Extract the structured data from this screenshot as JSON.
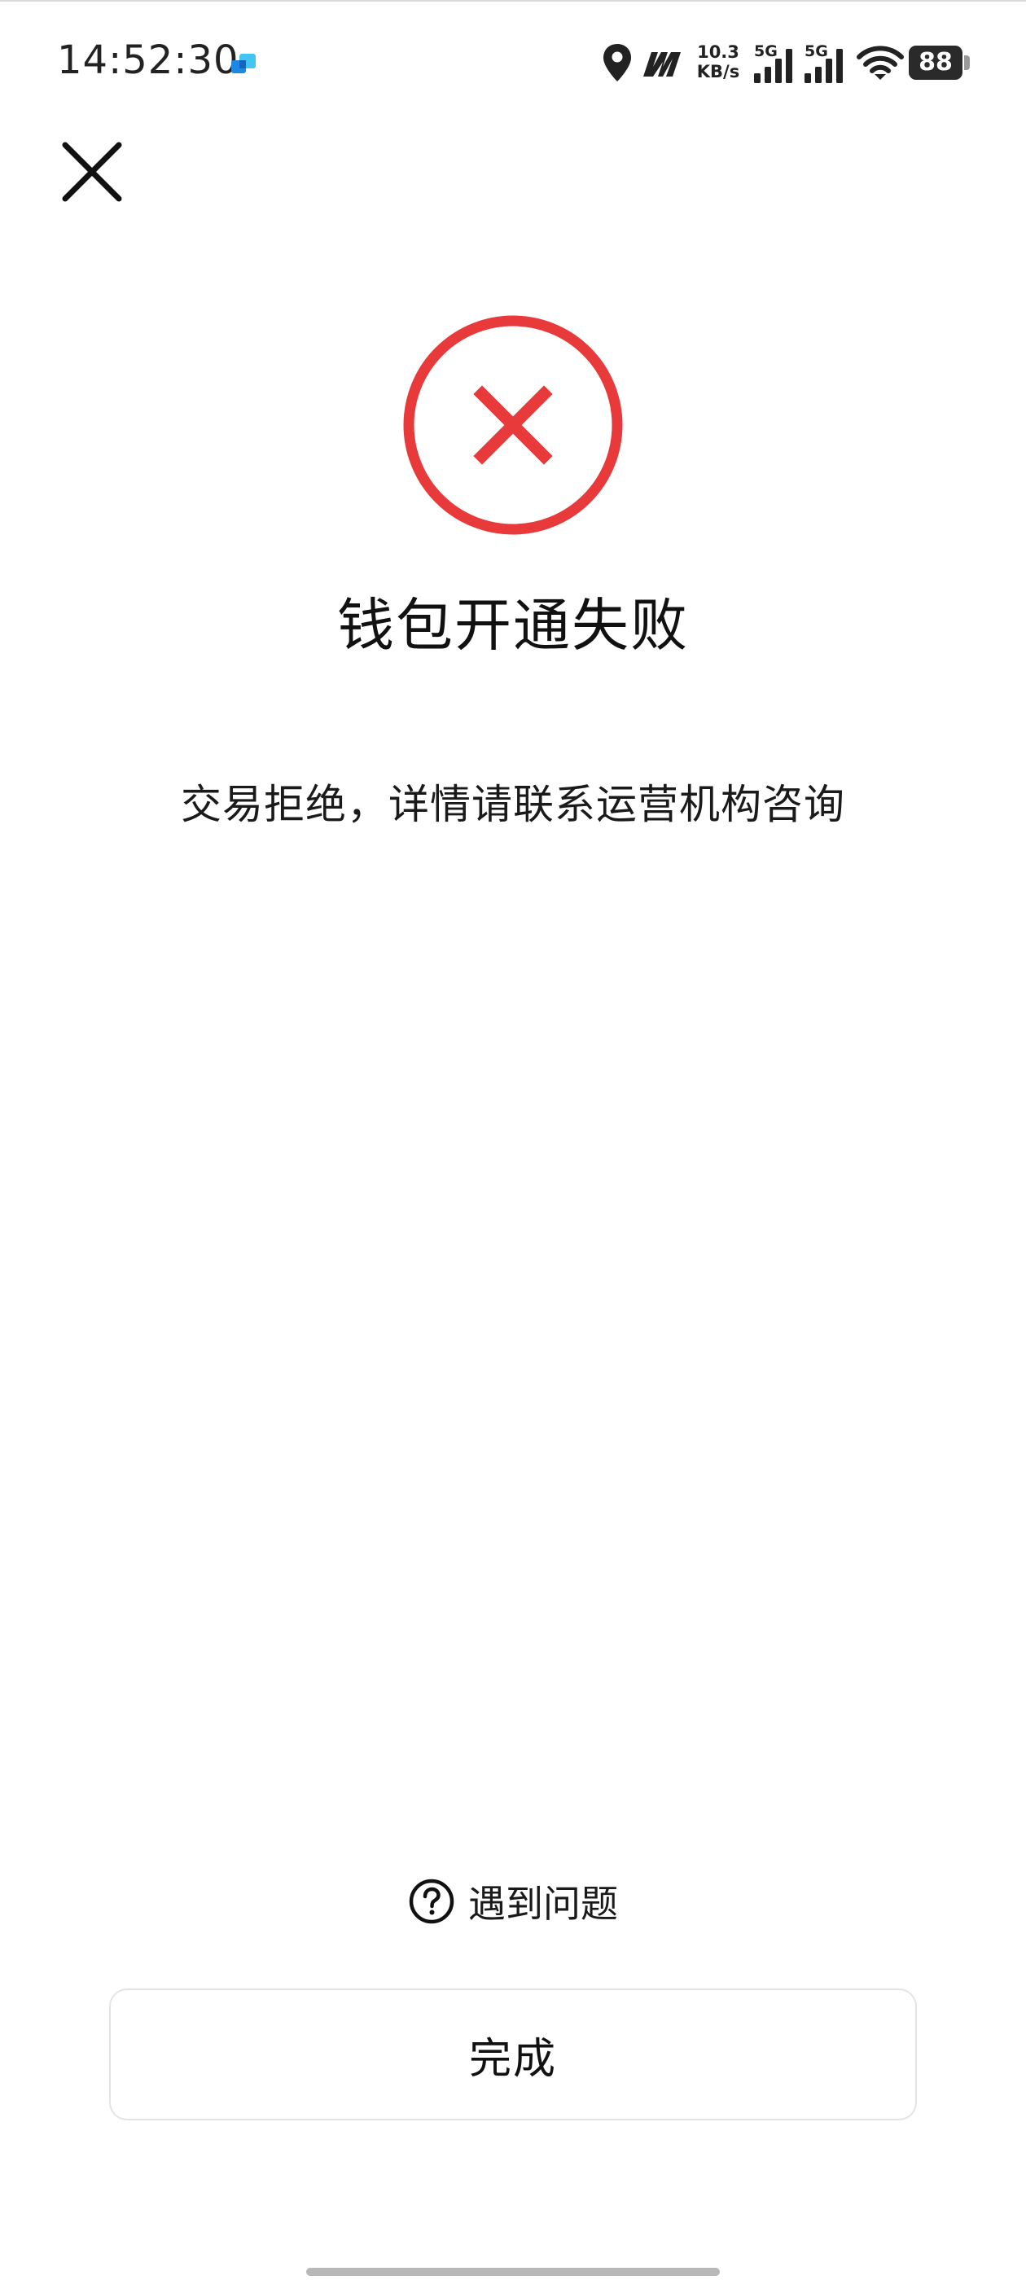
{
  "status_bar": {
    "time": "14:52:30",
    "net_speed_value": "10.3",
    "net_speed_unit": "KB/s",
    "sim1_label": "5G",
    "sim2_label": "5G",
    "battery": "88"
  },
  "result": {
    "title": "钱包开通失败",
    "message": "交易拒绝，详情请联系运营机构咨询",
    "status_color": "#e83a3a"
  },
  "help": {
    "label": "遇到问题"
  },
  "footer": {
    "done_label": "完成"
  },
  "icons": {
    "close": "close-icon",
    "result": "error-circle-icon",
    "help": "question-circle-icon"
  }
}
